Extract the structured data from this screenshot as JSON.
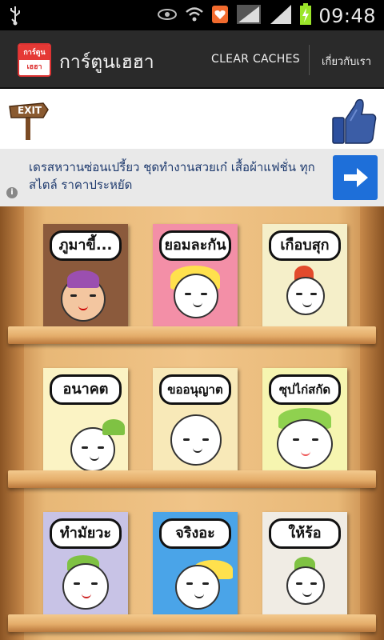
{
  "status_bar": {
    "time": "09:48",
    "icons": [
      "usb-icon",
      "eye-icon",
      "wifi-icon",
      "heart-notification-icon",
      "signal-icon",
      "signal-icon",
      "battery-charging-icon"
    ]
  },
  "action_bar": {
    "title": "การ์ตูนเฮฮา",
    "icon_top": "การ์ตูน",
    "icon_bottom": "เฮฮา",
    "clear_caches": "CLEAR CACHES",
    "about": "เกี่ยวกับเรา"
  },
  "top_bar": {
    "exit_label": "EXIT",
    "like_icon": "thumbs-up-icon"
  },
  "ad": {
    "text": "เดรสหวานซ่อนเปรี้ยว ชุดทำงานสวยเก๋ เสื้อผ้าแฟชั่น ทุกสไตล์ ราคาประหยัด",
    "info": "i"
  },
  "colors": {
    "action_bar": "#2a2a2a",
    "ad_button": "#1e6fd9",
    "shelf_wood": "#f0c488"
  },
  "books": [
    {
      "title": "ภูมาขี้...",
      "bg": "#8b5a3c"
    },
    {
      "title": "ยอมละกัน",
      "bg": "#f38fa7"
    },
    {
      "title": "เกือบสุก",
      "bg": "#f5efc9"
    },
    {
      "title": "อนาคต",
      "bg": "#fbf3c4"
    },
    {
      "title": "ขออนุญาต",
      "bg": "#f8e9b8"
    },
    {
      "title": "ซุปไก่สกัด",
      "bg": "#f6f5b0"
    },
    {
      "title": "ทำมัยวะ",
      "bg": "#c8c3e6"
    },
    {
      "title": "จริงอะ",
      "bg": "#4aa4e8"
    },
    {
      "title": "ให้ร้อ",
      "bg": "#f0ece4"
    }
  ]
}
